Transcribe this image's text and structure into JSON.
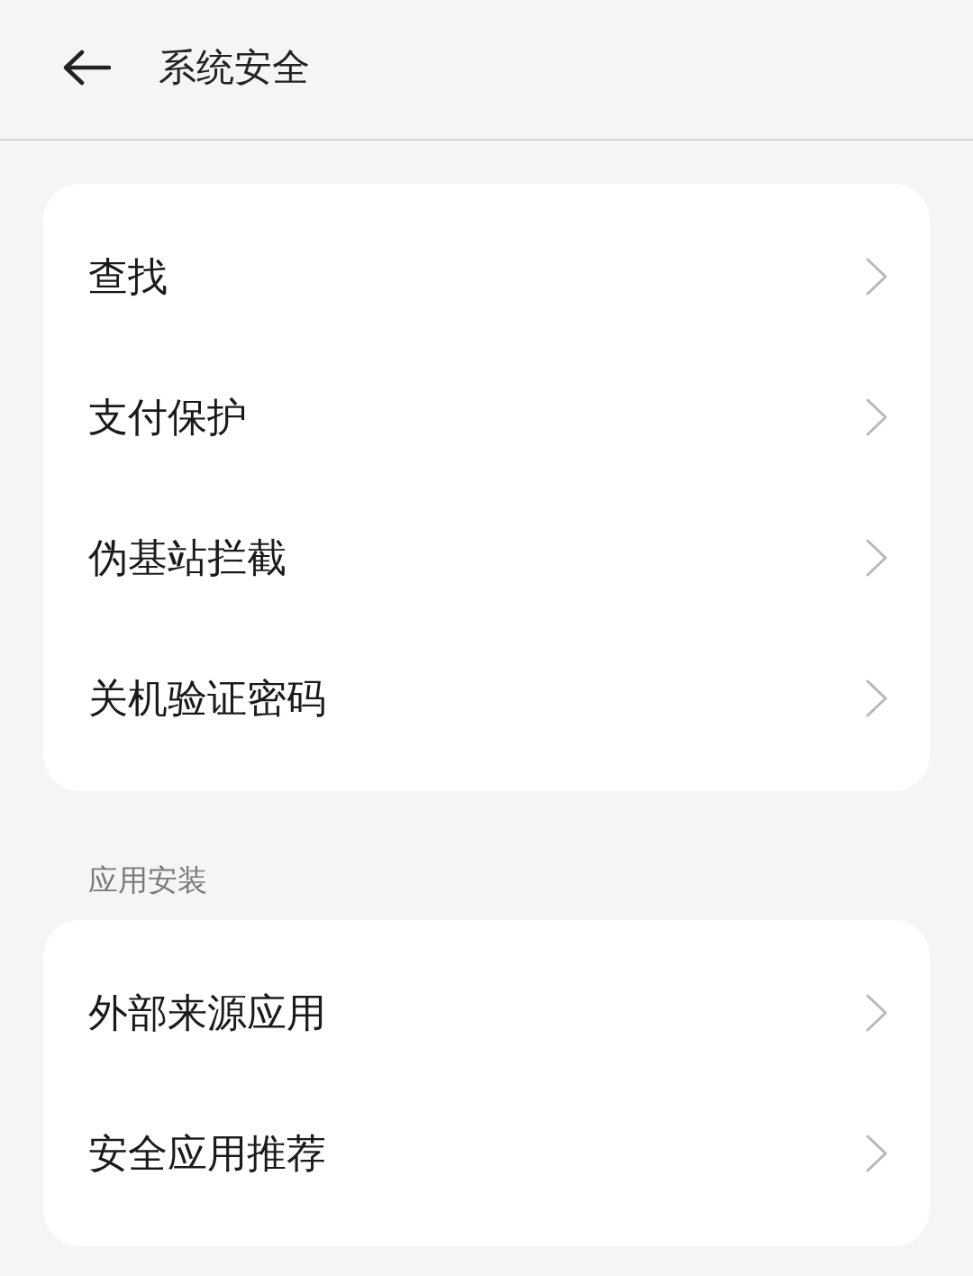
{
  "header": {
    "title": "系统安全"
  },
  "sections": [
    {
      "items": [
        "查找",
        "支付保护",
        "伪基站拦截",
        "关机验证密码"
      ]
    },
    {
      "label": "应用安装",
      "items": [
        "外部来源应用",
        "安全应用推荐"
      ]
    }
  ]
}
